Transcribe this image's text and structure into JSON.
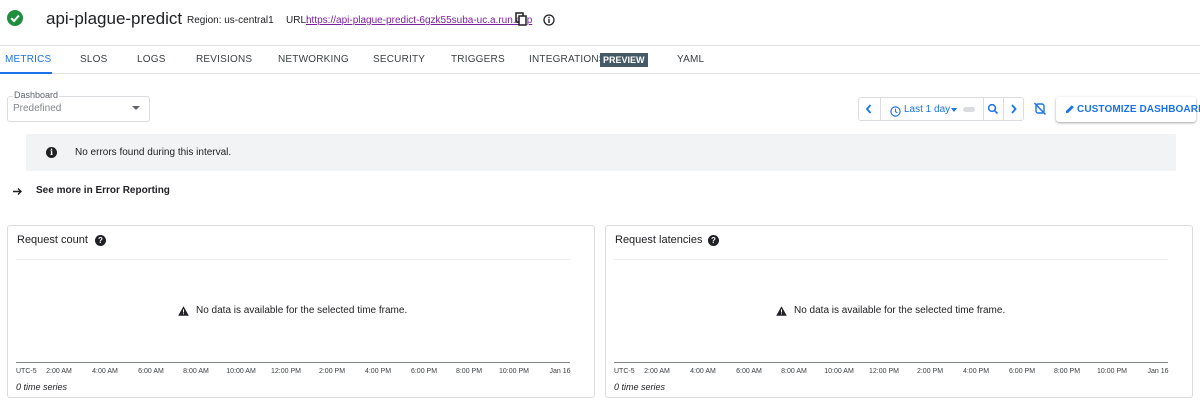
{
  "header": {
    "service_name": "api-plague-predict",
    "region": "Region: us-central1",
    "url_label": "URL:",
    "url": "https://api-plague-predict-6gzk55suba-uc.a.run.app"
  },
  "tabs": [
    {
      "label": "METRICS",
      "active": true
    },
    {
      "label": "SLOS"
    },
    {
      "label": "LOGS"
    },
    {
      "label": "REVISIONS"
    },
    {
      "label": "NETWORKING"
    },
    {
      "label": "SECURITY"
    },
    {
      "label": "TRIGGERS"
    },
    {
      "label": "INTEGRATIONS"
    },
    {
      "label": "YAML"
    }
  ],
  "preview_badge": "PREVIEW",
  "dashboard": {
    "label": "Dashboard",
    "value": "Predefined"
  },
  "toolbar": {
    "time_range": "Last 1 day",
    "customize_label": "CUSTOMIZE DASHBOARD"
  },
  "notice": {
    "text": "No errors found during this interval."
  },
  "see_more": "See more in Error Reporting",
  "charts": [
    {
      "title": "Request count",
      "no_data": "No data is available for the selected time frame.",
      "series_count": "0 time series"
    },
    {
      "title": "Request latencies",
      "no_data": "No data is available for the selected time frame.",
      "series_count": "0 time series"
    }
  ],
  "axis_ticks": [
    "UTC-5",
    "2:00 AM",
    "4:00 AM",
    "6:00 AM",
    "8:00 AM",
    "10:00 AM",
    "12:00 PM",
    "2:00 PM",
    "4:00 PM",
    "6:00 PM",
    "8:00 PM",
    "10:00 PM",
    "Jan 16"
  ],
  "colors": {
    "accent": "#1a73e8",
    "success": "#1e8e3e",
    "link_visited": "#7b1fa2",
    "badge": "#455a64"
  }
}
